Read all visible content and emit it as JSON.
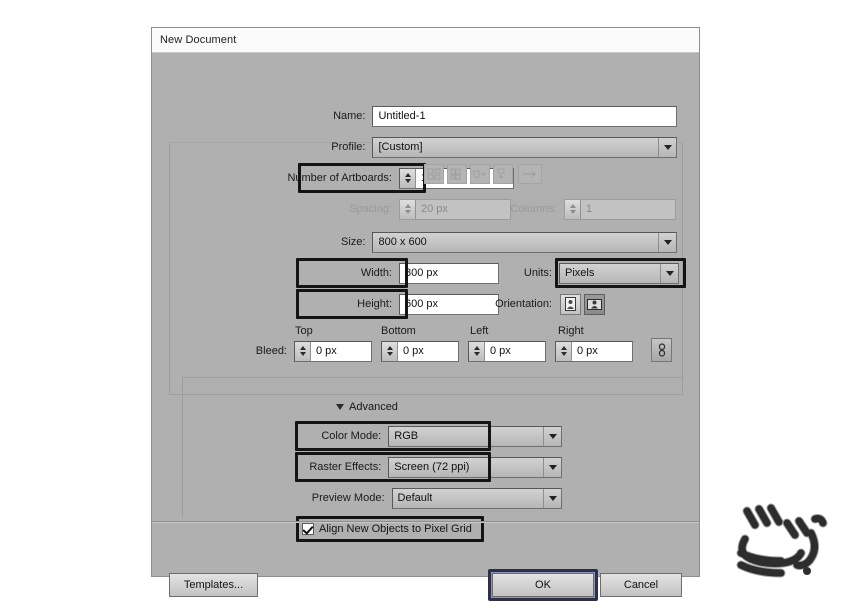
{
  "dialog": {
    "title": "New Document",
    "name_label": "Name:",
    "name_value": "Untitled-1",
    "profile_label": "Profile:",
    "profile_value": "[Custom]",
    "artboards_label": "Number of Artboards:",
    "artboards_value": "1",
    "spacing_label": "Spacing:",
    "spacing_value": "20 px",
    "columns_label": "Columns:",
    "columns_value": "1",
    "size_label": "Size:",
    "size_value": "800 x 600",
    "width_label": "Width:",
    "width_value": "800 px",
    "height_label": "Height:",
    "height_value": "600 px",
    "units_label": "Units:",
    "units_value": "Pixels",
    "orientation_label": "Orientation:",
    "bleed_label": "Bleed:",
    "bleed_caps": [
      "Top",
      "Bottom",
      "Left",
      "Right"
    ],
    "bleed_values": [
      "0 px",
      "0 px",
      "0 px",
      "0 px"
    ],
    "advanced_label": "Advanced",
    "color_mode_label": "Color Mode:",
    "color_mode_value": "RGB",
    "raster_label": "Raster Effects:",
    "raster_value": "Screen (72 ppi)",
    "preview_label": "Preview Mode:",
    "preview_value": "Default",
    "align_pixel_label": "Align New Objects to Pixel Grid",
    "templates_label": "Templates...",
    "ok_label": "OK",
    "cancel_label": "Cancel"
  },
  "colors": {
    "dialog_bg": "#b0b0b0",
    "titlebar_bg": "#fbfbfb",
    "field_bg": "#ffffff",
    "highlight_outline": "#141414",
    "ok_focus_ring": "#2e2f4a",
    "disabled_text": "#999999"
  }
}
